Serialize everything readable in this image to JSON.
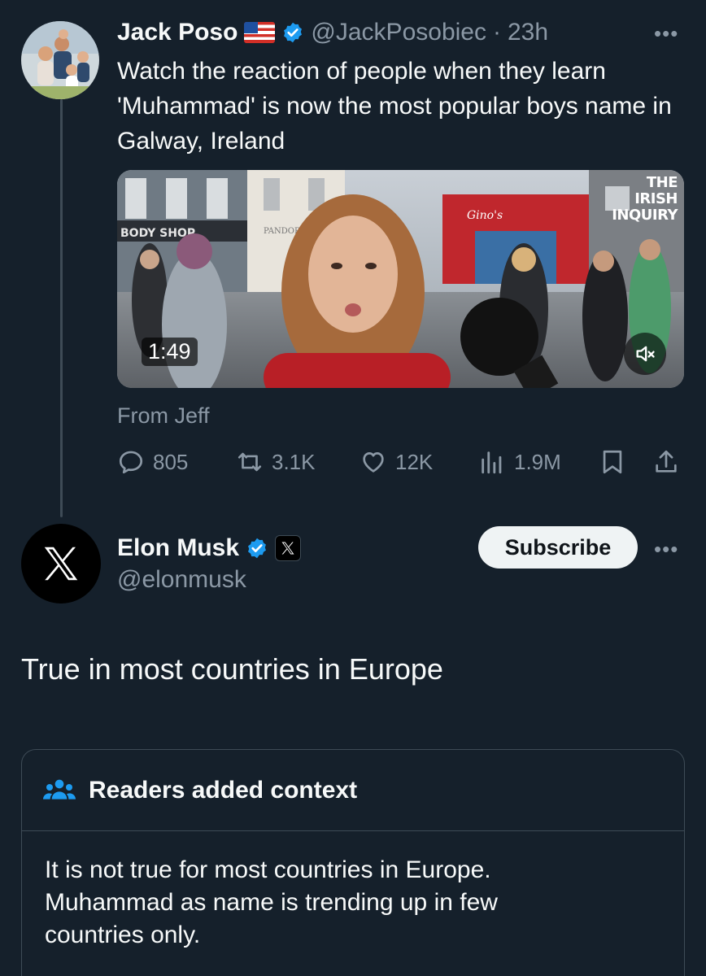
{
  "tweet1": {
    "author_name": "Jack Poso",
    "handle": "@JackPosobiec",
    "separator": "·",
    "time": "23h",
    "text": "Watch the reaction of people when they learn 'Muhammad' is now the most popular boys name in Galway, Ireland",
    "media": {
      "duration": "1:49",
      "watermark_line1": "THE",
      "watermark_line2": "IRISH",
      "watermark_line3": "INQUIRY",
      "shop_sign_left": "BODY SHOP",
      "shop_sign_middle": "PANDORA",
      "shop_sign_right": "Gino's"
    },
    "source_label": "From Jeff",
    "stats": {
      "replies": "805",
      "reposts": "3.1K",
      "likes": "12K",
      "views": "1.9M"
    },
    "icons": [
      "us-flag-icon",
      "verified-badge-icon",
      "more-icon",
      "reply-icon",
      "repost-icon",
      "like-icon",
      "views-icon",
      "bookmark-icon",
      "share-icon",
      "mute-icon"
    ]
  },
  "tweet2": {
    "author_name": "Elon Musk",
    "handle": "@elonmusk",
    "subscribe_label": "Subscribe",
    "text": "True in most countries in Europe",
    "icons": [
      "x-logo-icon",
      "verified-badge-icon",
      "x-affiliate-badge-icon",
      "more-icon"
    ]
  },
  "community_note": {
    "title": "Readers added context",
    "line1": "It is not true for most countries in Europe.",
    "line2": "Muhammad as name is trending up in few",
    "line3": "countries only.",
    "icon": "people-icon"
  },
  "colors": {
    "background": "#15202b",
    "primary_text": "#f7f9f9",
    "secondary_text": "#8b98a5",
    "verified_blue": "#1d9bf0",
    "note_icon_blue": "#1d9bf0",
    "border": "#3e4b56"
  }
}
